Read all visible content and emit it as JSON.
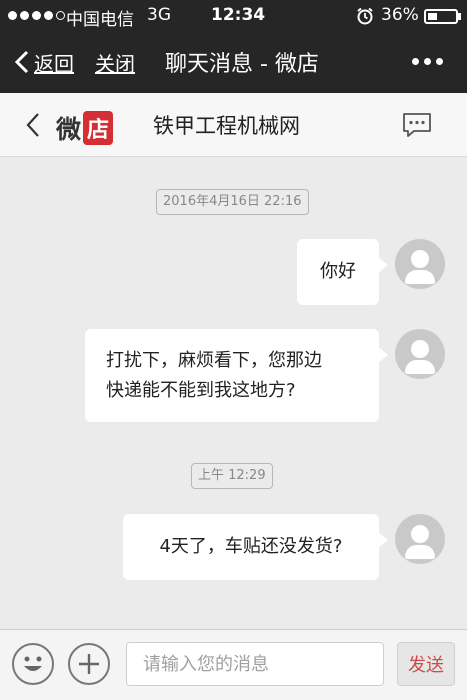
{
  "status_bar": {
    "carrier": "中国电信",
    "network": "3G",
    "time": "12:34",
    "battery_percent": "36%",
    "battery_level": 0.36
  },
  "nav": {
    "back_label": "返回",
    "close_label": "关闭",
    "title": "聊天消息 - 微店"
  },
  "shop": {
    "logo_part1": "微",
    "logo_part2": "店",
    "name": "铁甲工程机械网"
  },
  "conversation": {
    "timestamp_1": "2016年4月16日 22:16",
    "message_1": "你好",
    "message_2_line1": "打扰下，麻烦看下，您那边",
    "message_2_line2": "快递能不能到我这地方?",
    "timestamp_2": "上午 12:29",
    "message_3": "4天了，车贴还没发货?"
  },
  "input_bar": {
    "placeholder": "请输入您的消息",
    "send_label": "发送"
  },
  "colors": {
    "dark_bar": "#262626",
    "brand_red": "#d42f34",
    "send_text": "#d04a4a",
    "background": "#ebebeb"
  }
}
